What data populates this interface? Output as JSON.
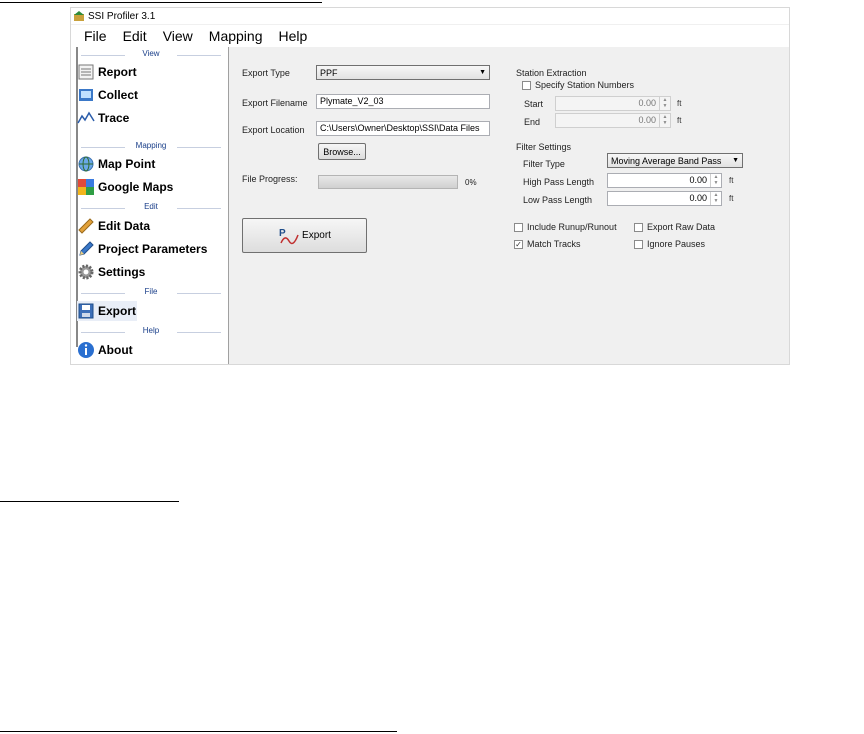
{
  "window": {
    "title": "SSI Profiler 3.1"
  },
  "menu": [
    "File",
    "Edit",
    "View",
    "Mapping",
    "Help"
  ],
  "sidebar": {
    "groups": {
      "view": "View",
      "mapping": "Mapping",
      "edit": "Edit",
      "file": "File",
      "help": "Help"
    },
    "items": {
      "report": "Report",
      "collect": "Collect",
      "trace": "Trace",
      "map_point": "Map Point",
      "google_maps": "Google Maps",
      "edit_data": "Edit Data",
      "project_parameters": "Project Parameters",
      "settings": "Settings",
      "export": "Export",
      "about": "About"
    }
  },
  "export_panel": {
    "type_label": "Export Type",
    "type_value": "PPF",
    "filename_label": "Export Filename",
    "filename_value": "Plymate_V2_03",
    "location_label": "Export Location",
    "location_value": "C:\\Users\\Owner\\Desktop\\SSI\\Data Files",
    "browse_label": "Browse...",
    "progress_label": "File Progress:",
    "progress_text": "0%",
    "progress_fraction": 0,
    "export_button": "Export"
  },
  "station_extraction": {
    "title": "Station Extraction",
    "specify_label": "Specify Station Numbers",
    "specify_checked": false,
    "start_label": "Start",
    "start_value": "0.00",
    "end_label": "End",
    "end_value": "0.00",
    "unit": "ft"
  },
  "filter_settings": {
    "title": "Filter Settings",
    "type_label": "Filter Type",
    "type_value": "Moving Average Band Pass",
    "high_label": "High Pass Length",
    "high_value": "0.00",
    "low_label": "Low Pass Length",
    "low_value": "0.00",
    "unit": "ft"
  },
  "options": {
    "include_runup": {
      "label": "Include Runup/Runout",
      "checked": false
    },
    "export_raw": {
      "label": "Export Raw Data",
      "checked": false
    },
    "match_tracks": {
      "label": "Match Tracks",
      "checked": true
    },
    "ignore_pauses": {
      "label": "Ignore Pauses",
      "checked": false
    }
  }
}
